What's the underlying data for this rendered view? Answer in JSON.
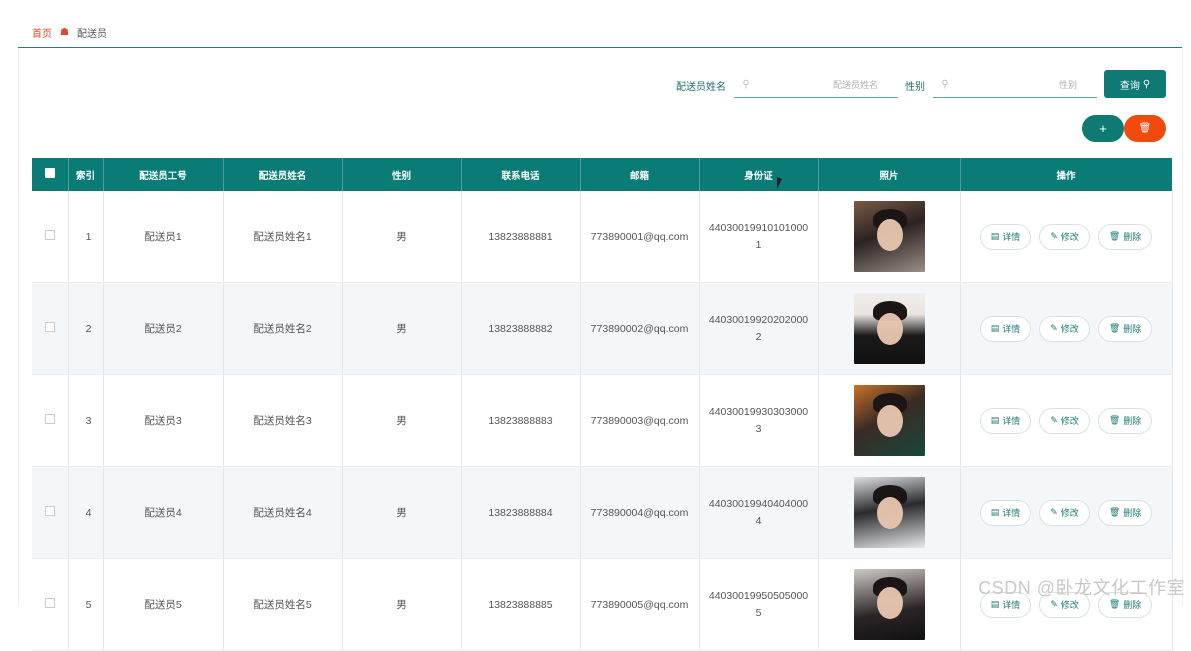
{
  "breadcrumb": {
    "home": "首页",
    "separator_icon": "home-icon",
    "current": "配送员"
  },
  "search": {
    "name_label": "配送员姓名",
    "name_placeholder": "配送员姓名",
    "gender_label": "性别",
    "gender_placeholder": "性别",
    "query_label": "查询"
  },
  "actions": {
    "add_label": "+",
    "delete_icon": "trash-icon"
  },
  "table": {
    "columns": [
      "索引",
      "配送员工号",
      "配送员姓名",
      "性别",
      "联系电话",
      "邮箱",
      "身份证",
      "照片",
      "操作"
    ],
    "rows": [
      {
        "index": "1",
        "worker_no": "配送员1",
        "name": "配送员姓名1",
        "gender": "男",
        "phone": "13823888881",
        "email": "773890001@qq.com",
        "id_card": "440300199101010001"
      },
      {
        "index": "2",
        "worker_no": "配送员2",
        "name": "配送员姓名2",
        "gender": "男",
        "phone": "13823888882",
        "email": "773890002@qq.com",
        "id_card": "440300199202020002"
      },
      {
        "index": "3",
        "worker_no": "配送员3",
        "name": "配送员姓名3",
        "gender": "男",
        "phone": "13823888883",
        "email": "773890003@qq.com",
        "id_card": "440300199303030003"
      },
      {
        "index": "4",
        "worker_no": "配送员4",
        "name": "配送员姓名4",
        "gender": "男",
        "phone": "13823888884",
        "email": "773890004@qq.com",
        "id_card": "440300199404040004"
      },
      {
        "index": "5",
        "worker_no": "配送员5",
        "name": "配送员姓名5",
        "gender": "男",
        "phone": "13823888885",
        "email": "773890005@qq.com",
        "id_card": "440300199505050005"
      }
    ],
    "op_labels": {
      "detail": "详情",
      "edit": "修改",
      "delete": "删除"
    }
  },
  "watermark": "CSDN @卧龙文化工作室",
  "colors": {
    "primary": "#0a7b75",
    "danger": "#f24a0e",
    "breadcrumb_home": "#e0472b"
  }
}
